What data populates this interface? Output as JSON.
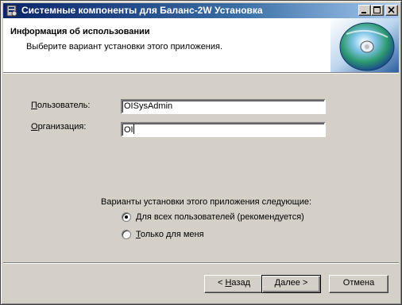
{
  "window": {
    "title": "Системные компоненты для Баланс-2W Установка"
  },
  "header": {
    "title": "Информация об использовании",
    "subtitle": "Выберите вариант установки этого приложения."
  },
  "form": {
    "user_label_accel": "П",
    "user_label_rest": "ользователь:",
    "user_value": "OISysAdmin",
    "org_label_accel": "О",
    "org_label_rest": "рганизация:",
    "org_value": "OI"
  },
  "install_options": {
    "prompt": "Варианты установки этого приложения следующие:",
    "all_users_accel": "Д",
    "all_users_rest": "ля всех пользователей (рекомендуется)",
    "only_me_accel": "Т",
    "only_me_rest": "олько для меня",
    "selected": "all_users"
  },
  "buttons": {
    "back_prefix": "< ",
    "back_accel": "Н",
    "back_rest": "азад",
    "next_accel": "Д",
    "next_rest": "алее >",
    "cancel": "Отмена"
  }
}
